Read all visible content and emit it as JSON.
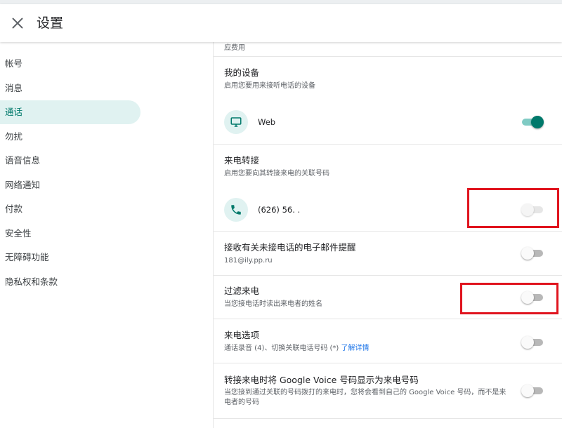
{
  "header": {
    "title": "设置"
  },
  "sidebar": {
    "items": [
      {
        "label": "帐号",
        "active": false
      },
      {
        "label": "消息",
        "active": false
      },
      {
        "label": "通话",
        "active": true
      },
      {
        "label": "勿扰",
        "active": false
      },
      {
        "label": "语音信息",
        "active": false
      },
      {
        "label": "网络通知",
        "active": false
      },
      {
        "label": "付款",
        "active": false
      },
      {
        "label": "安全性",
        "active": false
      },
      {
        "label": "无障碍功能",
        "active": false
      },
      {
        "label": "隐私权和条款",
        "active": false
      }
    ]
  },
  "content": {
    "partial_top": "应费用",
    "my_devices": {
      "title": "我的设备",
      "subtitle": "启用您要用来接听电话的设备",
      "device_label": "Web",
      "device_icon": "monitor-icon",
      "enabled": true
    },
    "forwarding": {
      "title": "来电转接",
      "subtitle": "启用您要向其转接来电的关联号码",
      "number_label": "(626) 56. .",
      "number_icon": "phone-icon",
      "enabled": false
    },
    "missed_call_email": {
      "title": "接收有关未接电话的电子邮件提醒",
      "subtitle": "181@ily.pp.ru",
      "enabled": false
    },
    "screen_calls": {
      "title": "过滤来电",
      "subtitle": "当您接电话时读出来电者的姓名",
      "enabled": false
    },
    "call_options": {
      "title": "来电选项",
      "subtitle": "通话录音 (4)、切换关联电话号码 (*) ",
      "link": "了解详情",
      "enabled": false
    },
    "show_gv_number": {
      "title": "转接来电时将 Google Voice 号码显示为来电号码",
      "subtitle_line1": "当您接到通过关联的号码拨打的来电时，您将会看到自己的 Google Voice 号码，而不是来",
      "subtitle_line2": "电者的号码",
      "enabled": false
    }
  },
  "colors": {
    "accent": "#00796b",
    "accent_light": "#e0f2f1",
    "highlight": "#e0141e",
    "link": "#1a73e8"
  }
}
